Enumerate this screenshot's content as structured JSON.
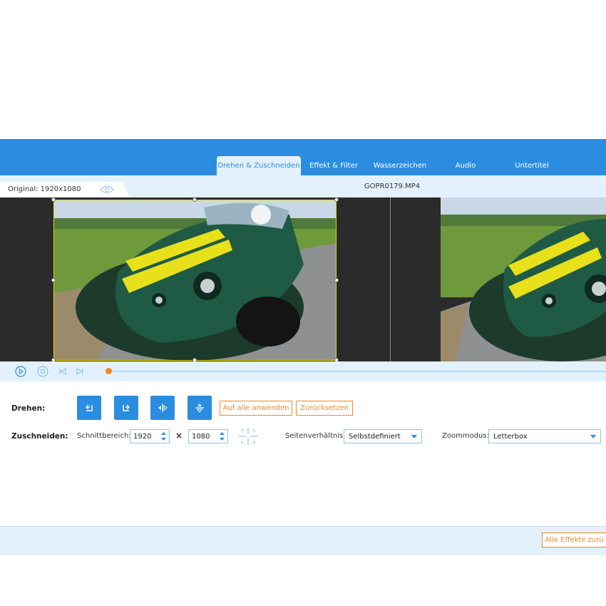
{
  "tabs": [
    {
      "label": "Drehen & Zuschneiden",
      "active": true
    },
    {
      "label": "Effekt & Filter",
      "active": false
    },
    {
      "label": "Wasserzeichen",
      "active": false
    },
    {
      "label": "Audio",
      "active": false
    },
    {
      "label": "Untertitel",
      "active": false
    }
  ],
  "info": {
    "original_label": "Original: 1920x1080",
    "filename": "GOPR0179.MP4"
  },
  "player": {
    "progress": 0.0
  },
  "rotate": {
    "label": "Drehen:",
    "buttons": [
      "rotate-left-icon",
      "rotate-right-icon",
      "flip-horizontal-icon",
      "flip-vertical-icon"
    ],
    "apply_all": "Auf alle anwenden",
    "reset": "Zurücksetzen"
  },
  "crop": {
    "label": "Zuschneiden:",
    "area_label": "Schnittbereich:",
    "width": "1920",
    "times": "×",
    "height": "1080",
    "aspect_label": "Seitenverhältnis:",
    "aspect_value": "Selbstdefiniert",
    "zoom_label": "Zoommodus:",
    "zoom_value": "Letterbox"
  },
  "footer": {
    "reset_all": "Alle Effekte zurü"
  },
  "colors": {
    "accent": "#2b8de0",
    "orange": "#f08a24",
    "light": "#e3f1fc"
  }
}
